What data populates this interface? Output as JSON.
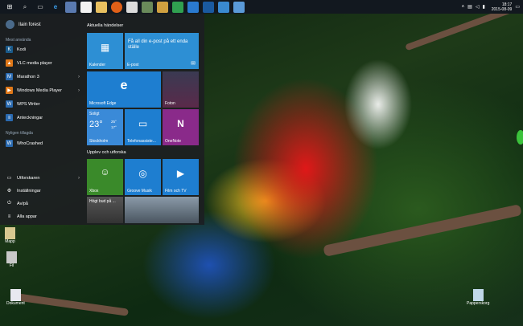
{
  "taskbar": {
    "icons": [
      "windows-logo-icon",
      "search-icon",
      "task-view-icon",
      "edge-icon",
      "photos-icon",
      "store-icon",
      "explorer-icon",
      "firefox-icon",
      "app-icon",
      "app-icon",
      "app-icon",
      "app-icon",
      "app-icon",
      "app-icon",
      "app-icon"
    ],
    "clock_time": "18:17",
    "clock_date": "2015-08-09"
  },
  "start": {
    "user": "Ilain forest",
    "most_used_label": "Mest använda",
    "most_used": [
      {
        "label": "Kodi",
        "color": "#1a5a8a",
        "icon": "K"
      },
      {
        "label": "VLC media player",
        "color": "#e07818",
        "icon": "▲"
      },
      {
        "label": "Marathon 3",
        "color": "#2a6ab0",
        "icon": "M"
      },
      {
        "label": "Windows Media Player",
        "color": "#e07818",
        "icon": "▶"
      },
      {
        "label": "WPS Writer",
        "color": "#2a6ab0",
        "icon": "W"
      },
      {
        "label": "Anteckningar",
        "color": "#2a6ab0",
        "icon": "≡"
      }
    ],
    "recent_label": "Nyligen tillagda",
    "recent": [
      {
        "label": "WhoCrashed",
        "color": "#2a6ab0",
        "icon": "W"
      }
    ],
    "bottom": [
      {
        "label": "Utforskaren",
        "icon": "▭"
      },
      {
        "label": "Inställningar",
        "icon": "⚙"
      },
      {
        "label": "Av/på",
        "icon": "⏻"
      },
      {
        "label": "Alla appar",
        "icon": "≡"
      }
    ],
    "group1": "Aktuella händelser",
    "group2": "Upplev och utforska",
    "tiles": {
      "calendar": "Kalender",
      "mail_text": "Få all din e-post på ett enda ställe",
      "mail": "E-post",
      "edge": "Microsoft Edge",
      "photos": "Foton",
      "weather_cond": "Soligt",
      "weather_temp": "23°",
      "weather_hi": "25°",
      "weather_lo": "17°",
      "weather_city": "Stockholm",
      "phone": "Telefonassiste...",
      "onenote": "OneNote",
      "xbox": "Xbox",
      "groove": "Groove Musik",
      "film": "Film och TV",
      "news": "Högt bud på ..."
    }
  },
  "desktop": {
    "icons": [
      {
        "label": "Mapp"
      },
      {
        "label": "Fil"
      },
      {
        "label": "Dokument"
      },
      {
        "label": "Papperskorg"
      }
    ]
  }
}
